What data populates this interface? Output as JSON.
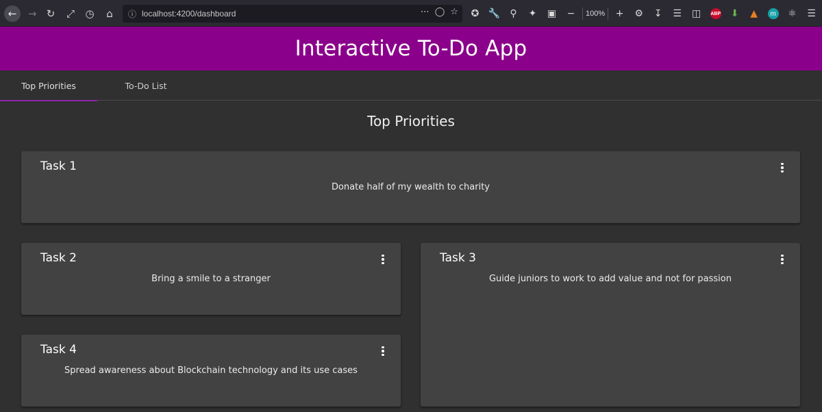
{
  "browser": {
    "url": "localhost:4200/dashboard",
    "zoom": "100%",
    "icons": {
      "back": "back-arrow-icon",
      "forward": "forward-arrow-icon",
      "reload": "reload-icon",
      "expand": "expand-icon",
      "history": "clock-icon",
      "home": "home-icon"
    },
    "extensions": {
      "abp": "ABP",
      "m": "m"
    }
  },
  "header": {
    "title": "Interactive To-Do App",
    "color": "#8b008b"
  },
  "tabs": [
    {
      "label": "Top Priorities",
      "active": true
    },
    {
      "label": "To-Do List",
      "active": false
    }
  ],
  "main": {
    "section_title": "Top Priorities",
    "tasks": [
      {
        "title": "Task 1",
        "description": "Donate half of my wealth to charity"
      },
      {
        "title": "Task 2",
        "description": "Bring a smile to a stranger"
      },
      {
        "title": "Task 3",
        "description": "Guide juniors to work to add value and not for passion"
      },
      {
        "title": "Task 4",
        "description": "Spread awareness about Blockchain technology and its use cases"
      }
    ]
  },
  "colors": {
    "background": "#303030",
    "card": "#424242",
    "tab_indicator": "#8e24aa"
  }
}
